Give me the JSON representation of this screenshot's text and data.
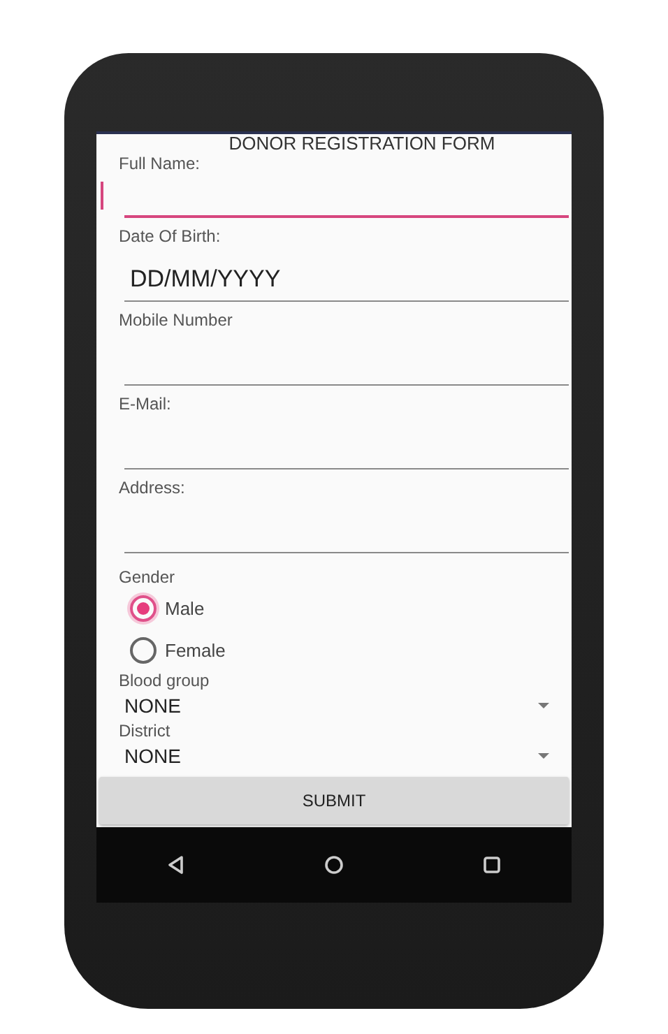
{
  "form": {
    "title": "DONOR REGISTRATION FORM",
    "fields": [
      {
        "label": "Full Name:",
        "focused": true
      },
      {
        "label": "Date Of Birth:",
        "value": "DD/MM/YYYY",
        "focused": false
      },
      {
        "label": "Mobile Number",
        "focused": false
      },
      {
        "label": "E-Mail:",
        "focused": false
      },
      {
        "label": "Address:",
        "focused": false
      }
    ],
    "gender": {
      "label": "Gender",
      "options": [
        {
          "label": "Male",
          "selected": true
        },
        {
          "label": "Female",
          "selected": false
        }
      ]
    },
    "dropdowns": [
      {
        "label": "Blood group",
        "value": "NONE"
      },
      {
        "label": "District",
        "value": "NONE"
      }
    ],
    "submit": "SUBMIT"
  }
}
